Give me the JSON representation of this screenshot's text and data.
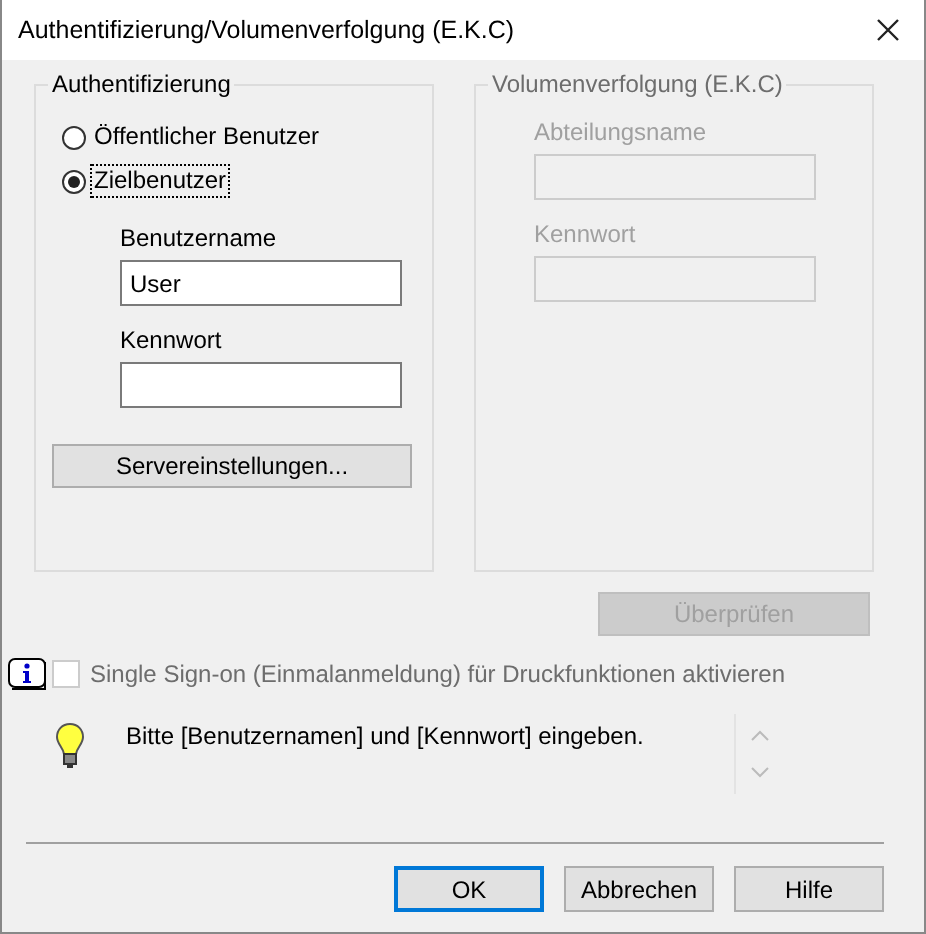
{
  "window": {
    "title": "Authentifizierung/Volumenverfolgung (E.K.C)"
  },
  "authentication": {
    "legend": "Authentifizierung",
    "options": [
      {
        "label": "Öffentlicher Benutzer",
        "selected": false
      },
      {
        "label": "Zielbenutzer",
        "selected": true
      }
    ],
    "fields": [
      {
        "label": "Benutzername",
        "value": "User"
      },
      {
        "label": "Kennwort"
      }
    ],
    "server_button": "Servereinstellungen..."
  },
  "volume_tracking": {
    "legend": "Volumenverfolgung (E.K.C)",
    "disabled": true,
    "fields": [
      {
        "label": "Abteilungsname"
      },
      {
        "label": "Kennwort"
      }
    ]
  },
  "check_button": {
    "label": "Überprüfen",
    "disabled": true
  },
  "sso": {
    "label": "Single Sign-on (Einmalanmeldung) für Druckfunktionen aktivieren",
    "checked": false,
    "disabled": true
  },
  "message": {
    "text": "Bitte [Benutzernamen] und [Kennwort] eingeben."
  },
  "buttons": [
    {
      "label": "OK",
      "default": true
    },
    {
      "label": "Abbrechen",
      "default": false
    },
    {
      "label": "Hilfe",
      "default": false
    }
  ]
}
